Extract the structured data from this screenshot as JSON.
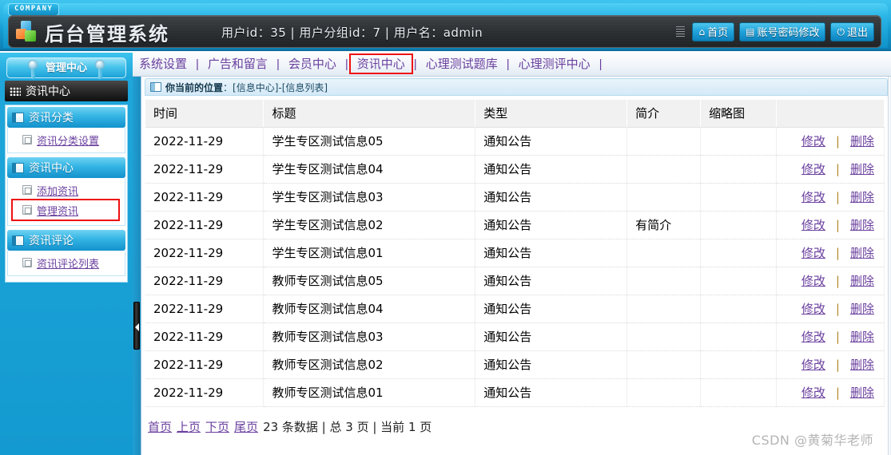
{
  "header": {
    "company_tag": "COMPANY",
    "title": "后台管理系统",
    "user_info": "用户id：35 | 用户分组id：7 | 用户名：admin",
    "buttons": [
      {
        "icon": "home-icon",
        "glyph": "⌂",
        "label": "首页"
      },
      {
        "icon": "document-icon",
        "glyph": "▤",
        "label": "账号密码修改"
      },
      {
        "icon": "power-icon",
        "glyph": "⏻",
        "label": "退出"
      }
    ],
    "accent_color": "#1fa6da",
    "bar_color": "#2a2d30"
  },
  "tabs": {
    "items": [
      {
        "label": "系统设置",
        "selected": false
      },
      {
        "label": "广告和留言",
        "selected": false
      },
      {
        "label": "会员中心",
        "selected": false
      },
      {
        "label": "资讯中心",
        "selected": true
      },
      {
        "label": "心理测试题库",
        "selected": false
      },
      {
        "label": "心理测评中心",
        "selected": false
      }
    ],
    "separator": "|",
    "highlight_color": "#ee1111",
    "link_color": "#6a3f9e"
  },
  "sidebar": {
    "panel_title": "管理中心",
    "current_module": "资讯中心",
    "groups": [
      {
        "label": "资讯分类",
        "items": [
          {
            "label": "资讯分类设置",
            "highlighted": false
          }
        ]
      },
      {
        "label": "资讯中心",
        "items": [
          {
            "label": "添加资讯",
            "highlighted": false
          },
          {
            "label": "管理资讯",
            "highlighted": true
          }
        ]
      },
      {
        "label": "资讯评论",
        "items": [
          {
            "label": "资讯评论列表",
            "highlighted": false
          }
        ]
      }
    ]
  },
  "breadcrumb": {
    "label": "你当前的位置",
    "separator": "：",
    "path": "[信息中心]-[信息列表]"
  },
  "table": {
    "columns": [
      "时间",
      "标题",
      "类型",
      "简介",
      "缩略图",
      ""
    ],
    "rows": [
      {
        "time": "2022-11-29",
        "title": "学生专区测试信息05",
        "type": "通知公告",
        "desc": "",
        "thumb": "",
        "edit": "修改",
        "sep": "|",
        "delete": "删除"
      },
      {
        "time": "2022-11-29",
        "title": "学生专区测试信息04",
        "type": "通知公告",
        "desc": "",
        "thumb": "",
        "edit": "修改",
        "sep": "|",
        "delete": "删除"
      },
      {
        "time": "2022-11-29",
        "title": "学生专区测试信息03",
        "type": "通知公告",
        "desc": "",
        "thumb": "",
        "edit": "修改",
        "sep": "|",
        "delete": "删除"
      },
      {
        "time": "2022-11-29",
        "title": "学生专区测试信息02",
        "type": "通知公告",
        "desc": "有简介",
        "thumb": "",
        "edit": "修改",
        "sep": "|",
        "delete": "删除"
      },
      {
        "time": "2022-11-29",
        "title": "学生专区测试信息01",
        "type": "通知公告",
        "desc": "",
        "thumb": "",
        "edit": "修改",
        "sep": "|",
        "delete": "删除"
      },
      {
        "time": "2022-11-29",
        "title": "教师专区测试信息05",
        "type": "通知公告",
        "desc": "",
        "thumb": "",
        "edit": "修改",
        "sep": "|",
        "delete": "删除"
      },
      {
        "time": "2022-11-29",
        "title": "教师专区测试信息04",
        "type": "通知公告",
        "desc": "",
        "thumb": "",
        "edit": "修改",
        "sep": "|",
        "delete": "删除"
      },
      {
        "time": "2022-11-29",
        "title": "教师专区测试信息03",
        "type": "通知公告",
        "desc": "",
        "thumb": "",
        "edit": "修改",
        "sep": "|",
        "delete": "删除"
      },
      {
        "time": "2022-11-29",
        "title": "教师专区测试信息02",
        "type": "通知公告",
        "desc": "",
        "thumb": "",
        "edit": "修改",
        "sep": "|",
        "delete": "删除"
      },
      {
        "time": "2022-11-29",
        "title": "教师专区测试信息01",
        "type": "通知公告",
        "desc": "",
        "thumb": "",
        "edit": "修改",
        "sep": "|",
        "delete": "删除"
      }
    ]
  },
  "pager": {
    "first": "首页",
    "prev": "上页",
    "next": "下页",
    "last": "尾页",
    "summary": "23 条数据 | 总 3 页 | 当前 1 页"
  },
  "watermark": "CSDN @黄菊华老师"
}
